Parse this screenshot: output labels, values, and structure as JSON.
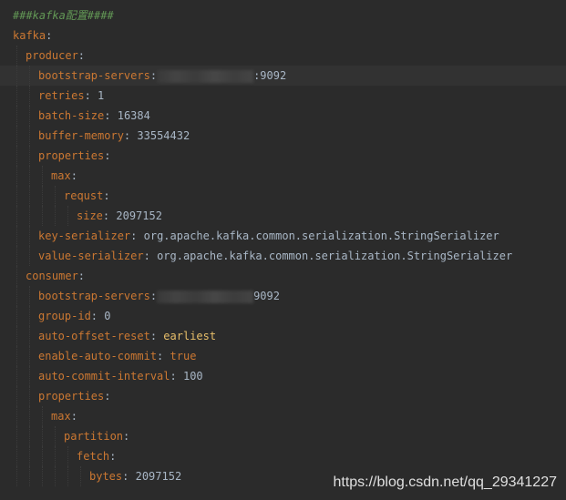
{
  "editor": {
    "lines": [
      {
        "type": "comment",
        "text": "###kafka配置####",
        "indent": 0
      },
      {
        "type": "key",
        "key": "kafka",
        "indent": 0
      },
      {
        "type": "key",
        "key": "producer",
        "indent": 1
      },
      {
        "type": "redacted",
        "key": "bootstrap-servers",
        "value": ":9092",
        "indent": 2,
        "current": true
      },
      {
        "type": "kv",
        "key": "retries",
        "value": "1",
        "indent": 2
      },
      {
        "type": "kv",
        "key": "batch-size",
        "value": "16384",
        "indent": 2
      },
      {
        "type": "kv",
        "key": "buffer-memory",
        "value": "33554432",
        "indent": 2
      },
      {
        "type": "key",
        "key": "properties",
        "indent": 2
      },
      {
        "type": "key",
        "key": "max",
        "indent": 3
      },
      {
        "type": "key",
        "key": "requst",
        "indent": 4
      },
      {
        "type": "kv",
        "key": "size",
        "value": "2097152",
        "indent": 5
      },
      {
        "type": "kv",
        "key": "key-serializer",
        "value": "org.apache.kafka.common.serialization.StringSerializer",
        "indent": 2
      },
      {
        "type": "kv",
        "key": "value-serializer",
        "value": "org.apache.kafka.common.serialization.StringSerializer",
        "indent": 2
      },
      {
        "type": "key",
        "key": "consumer",
        "indent": 1
      },
      {
        "type": "redacted",
        "key": "bootstrap-servers",
        "value": "9092",
        "indent": 2
      },
      {
        "type": "kv",
        "key": "group-id",
        "value": "0",
        "indent": 2
      },
      {
        "type": "kv",
        "key": "auto-offset-reset",
        "value": "earliest",
        "indent": 2,
        "valueStyle": "word"
      },
      {
        "type": "kv",
        "key": "enable-auto-commit",
        "value": "true",
        "indent": 2,
        "valueStyle": "bool"
      },
      {
        "type": "kv",
        "key": "auto-commit-interval",
        "value": "100",
        "indent": 2
      },
      {
        "type": "key",
        "key": "properties",
        "indent": 2
      },
      {
        "type": "key",
        "key": "max",
        "indent": 3
      },
      {
        "type": "key",
        "key": "partition",
        "indent": 4
      },
      {
        "type": "key",
        "key": "fetch",
        "indent": 5
      },
      {
        "type": "kv",
        "key": "bytes",
        "value": "2097152",
        "indent": 6
      }
    ]
  },
  "watermark": "https://blog.csdn.net/qq_29341227",
  "colors": {
    "background": "#2b2b2b",
    "key": "#cc7832",
    "comment": "#629755",
    "value": "#a9b7c6",
    "word_value": "#e8bf6a"
  }
}
